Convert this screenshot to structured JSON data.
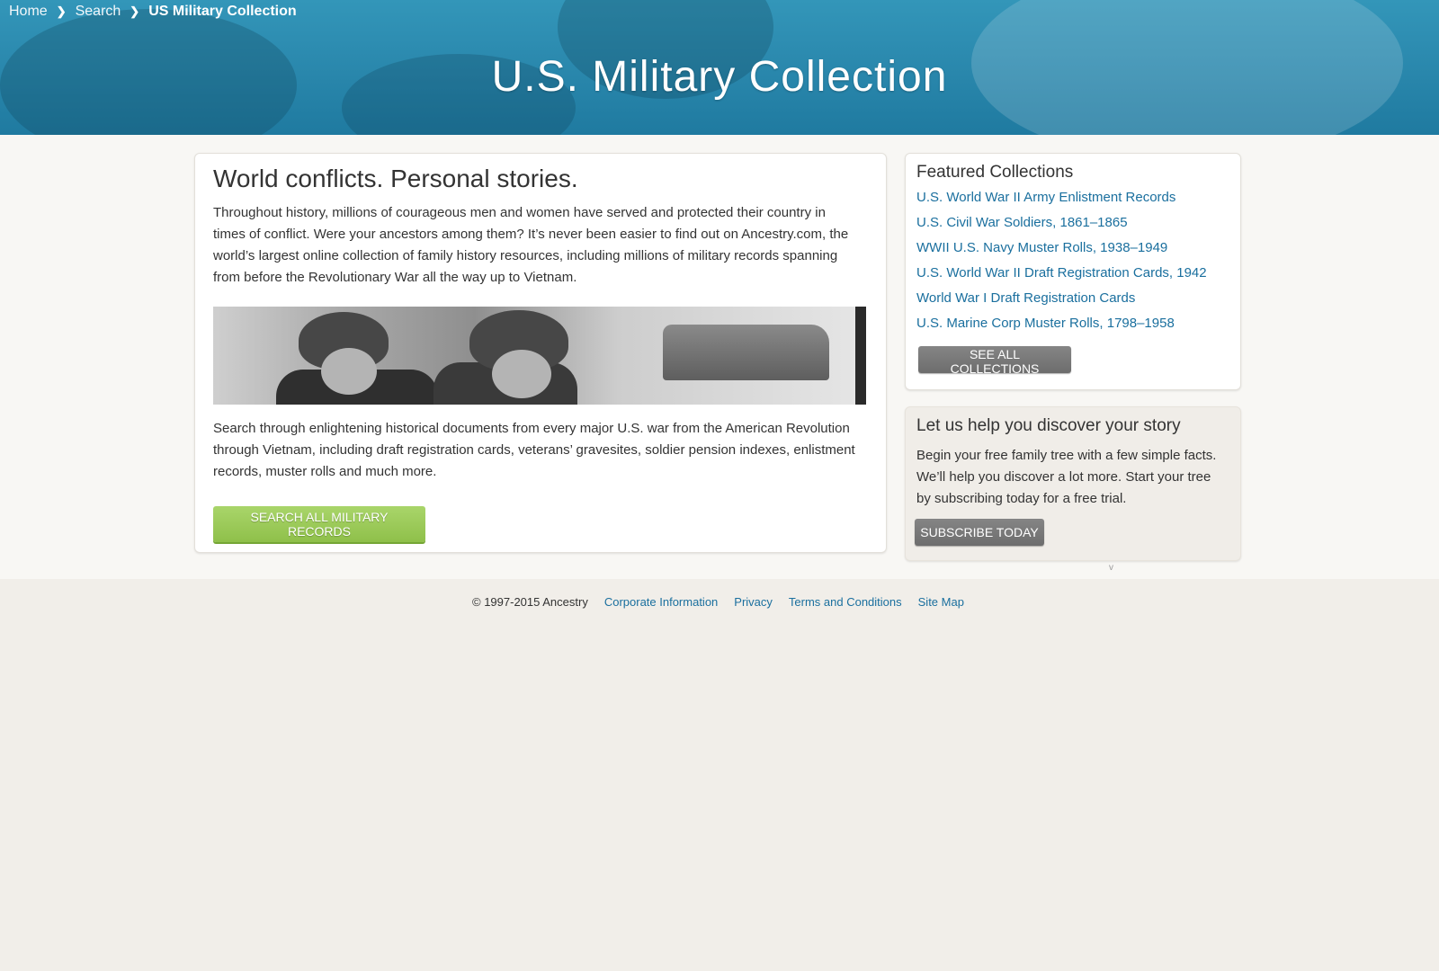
{
  "breadcrumb": {
    "items": [
      "Home",
      "Search"
    ],
    "current": "US Military Collection",
    "separator_icon": "chevron-right-icon"
  },
  "hero": {
    "title": "U.S. Military Collection"
  },
  "main": {
    "heading": "World conflicts. Personal stories.",
    "intro": "Throughout history, millions of courageous men and women have served and protected their country in times of conflict. Were your ancestors among them? It’s never been easier to find out on Ancestry.com, the world’s largest online collection of family history resources, including millions of military records spanning from before the Revolutionary War all the way up to Vietnam.",
    "outro": "Search through enlightening historical documents from every major U.S. war from the American Revolution through Vietnam, including draft registration cards, veterans’ gravesites, soldier pension indexes, enlistment records, muster rolls and much more.",
    "search_button": "Search all military records"
  },
  "featured": {
    "heading": "Featured Collections",
    "links": [
      "U.S. World War II Army Enlistment Records",
      "U.S. Civil War Soldiers, 1861–1865",
      "WWII U.S. Navy Muster Rolls, 1938–1949",
      "U.S. World War II Draft Registration Cards, 1942",
      "World War I Draft Registration Cards",
      "U.S. Marine Corp Muster Rolls, 1798–1958"
    ],
    "see_all_button": "See all collections"
  },
  "story": {
    "heading": "Let us help you discover your story",
    "body": "Begin your free family tree with a few simple facts. We’ll help you discover a lot more. Start your tree by subscribing today for a free trial.",
    "subscribe_button": "Subscribe today"
  },
  "stray_mark": "v",
  "footer": {
    "copyright": "© 1997-2015 Ancestry",
    "links": [
      "Corporate Information",
      "Privacy",
      "Terms and Conditions",
      "Site Map"
    ]
  },
  "colors": {
    "hero_blue": "#2a88ad",
    "link_blue": "#1a6f9e",
    "button_green": "#9cca58",
    "button_gray": "#777777",
    "page_bg": "#f1eee9"
  }
}
